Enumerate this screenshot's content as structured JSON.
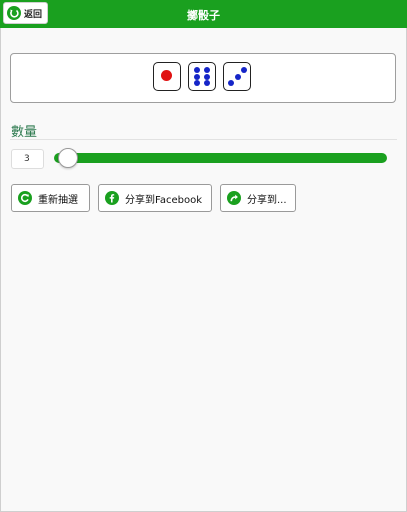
{
  "header": {
    "back_label": "返回",
    "title": "擲骰子",
    "accent_color": "#1aa01f"
  },
  "dice": {
    "values": [
      1,
      6,
      3
    ],
    "pip_color": "#1525c8",
    "one_pip_color": "#e01212"
  },
  "quantity": {
    "label": "數量",
    "value": "3",
    "slider_level_fraction": 0.0
  },
  "actions": {
    "redraw_label": "重新抽選",
    "share_facebook_label": "分享到Facebook",
    "share_other_label": "分享到..."
  },
  "icons": {
    "back": "circle-arrow-left-icon",
    "redraw": "refresh-icon",
    "facebook": "facebook-icon",
    "share": "share-arrow-icon"
  }
}
